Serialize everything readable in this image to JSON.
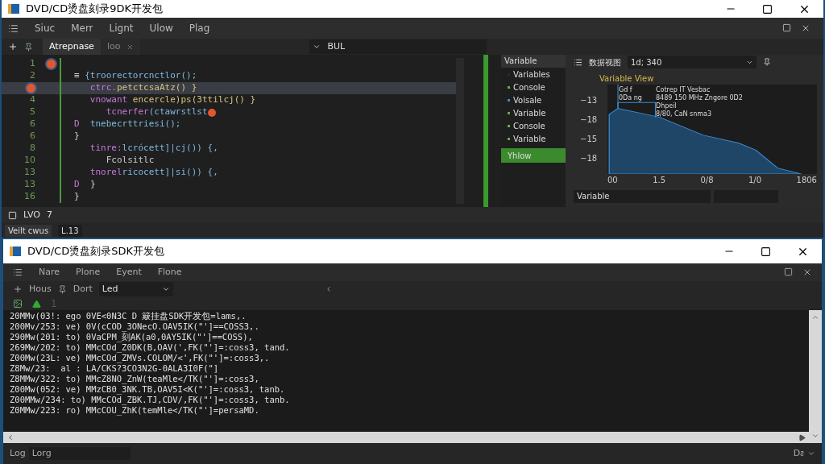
{
  "top_window": {
    "title": "DVD/CD烫盘刻录9DK开发包",
    "menu": [
      "Siuc",
      "Merr",
      "Lignt",
      "Ulow",
      "Plag"
    ],
    "tabs": [
      {
        "label": "Atrepnase",
        "selected": true,
        "closable": false
      },
      {
        "label": "loo",
        "selected": false,
        "closable": true
      }
    ],
    "search": {
      "value": "BUL"
    },
    "code_lines": [
      {
        "number": "1",
        "current": false,
        "gutter_breakpoint": true,
        "number_breakpoint": false,
        "end_breakpoint": false
      },
      {
        "number": "2",
        "current": false,
        "gutter_breakpoint": false,
        "number_breakpoint": false,
        "end_breakpoint": false,
        "parts": [
          {
            "kind": "punct",
            "text": "≡ "
          },
          {
            "kind": "name",
            "text": "{troorectorcnctlor();"
          }
        ]
      },
      {
        "current": true,
        "gutter_breakpoint": false,
        "number_breakpoint": true,
        "end_breakpoint": false,
        "parts": [
          {
            "kind": "keyword",
            "text": "   ctrc."
          },
          {
            "kind": "call",
            "text": "petctcsaAtz() }"
          }
        ]
      },
      {
        "number": "4",
        "current": false,
        "gutter_breakpoint": false,
        "number_breakpoint": false,
        "end_breakpoint": false,
        "parts": [
          {
            "kind": "keyword",
            "text": "   vnowant "
          },
          {
            "kind": "call",
            "text": "encercle)ps(3ttilcj() }"
          }
        ]
      },
      {
        "number": "5",
        "current": false,
        "gutter_breakpoint": false,
        "number_breakpoint": false,
        "end_breakpoint": true,
        "parts": [
          {
            "kind": "keyword",
            "text": "      tcnerfer"
          },
          {
            "kind": "name",
            "text": "(ctawrstlst"
          }
        ]
      },
      {
        "number": "6",
        "current": false,
        "gutter_breakpoint": false,
        "number_breakpoint": false,
        "end_breakpoint": false,
        "parts": [
          {
            "kind": "keyword",
            "text": "D  "
          },
          {
            "kind": "name",
            "text": "tnebecrttriesi();"
          }
        ]
      },
      {
        "number": "6",
        "current": false,
        "gutter_breakpoint": false,
        "number_breakpoint": false,
        "end_breakpoint": false,
        "parts": [
          {
            "kind": "punct",
            "text": "}"
          }
        ]
      },
      {
        "number": "8",
        "current": false,
        "gutter_breakpoint": false,
        "number_breakpoint": false,
        "end_breakpoint": false,
        "parts": [
          {
            "kind": "keyword",
            "text": "   tinre:"
          },
          {
            "kind": "name",
            "text": "lcrócett]|cj()) {,"
          }
        ]
      },
      {
        "number": "10",
        "current": false,
        "gutter_breakpoint": false,
        "number_breakpoint": false,
        "end_breakpoint": false,
        "parts": [
          {
            "kind": "plain",
            "text": "      Fcolsitlc"
          }
        ]
      },
      {
        "number": "13",
        "current": false,
        "gutter_breakpoint": false,
        "number_breakpoint": false,
        "end_breakpoint": false,
        "parts": [
          {
            "kind": "keyword",
            "text": "   tnorel"
          },
          {
            "kind": "name",
            "text": "ricocett]|si()) {,"
          }
        ]
      },
      {
        "number": "13",
        "current": false,
        "gutter_breakpoint": false,
        "number_breakpoint": false,
        "end_breakpoint": false,
        "parts": [
          {
            "kind": "keyword",
            "text": "D  "
          },
          {
            "kind": "punct",
            "text": "}"
          }
        ]
      },
      {
        "number": "16",
        "current": false,
        "gutter_breakpoint": false,
        "number_breakpoint": false,
        "end_breakpoint": false,
        "parts": [
          {
            "kind": "punct",
            "text": "}"
          }
        ]
      }
    ],
    "status": {
      "left": "LVO",
      "count": "7",
      "mode": "Veilt cwus",
      "position": "L.13"
    },
    "variables": {
      "header": "Variable",
      "items": [
        {
          "label": "Variables",
          "color": "#2b2b2b"
        },
        {
          "label": "Console",
          "color": "#6aa84f"
        },
        {
          "label": "Voisale",
          "color": "#4a86c8"
        },
        {
          "label": "Variable",
          "color": "#6aa84f"
        },
        {
          "label": "Console",
          "color": "#6aa84f"
        },
        {
          "label": "Variable",
          "color": "#6aa84f"
        }
      ],
      "button": "Yhlow"
    },
    "chart_panel": {
      "toolbar_label": "数据视图",
      "dropdown": "1d; 340",
      "title": "Variable View",
      "annotations": [
        "Gd f",
        "0Da ng",
        "Cotrep IT Vesbac",
        "8489 150 MHz Zngore 0D2",
        "Dhpeil",
        "8/80, CaN snma3"
      ],
      "y_ticks": [
        "−13",
        "−18",
        "−15",
        "−18"
      ],
      "x_ticks": [
        "00",
        "1.5",
        "0/8",
        "1/0",
        "1806"
      ],
      "footer": "Variable"
    }
  },
  "bottom_window": {
    "title": "DVD/CD烫盘刻录SDK开发包",
    "menu": [
      "Nare",
      "Plone",
      "Eyent",
      "Flone"
    ],
    "toolbar": {
      "add": "Hous",
      "pin": "Dort",
      "dropdown": "Led"
    },
    "row_count": "1",
    "log_lines": [
      "20MMv(03!: ego 0VE<0N3C D 簸挂盘SDK开发包=lams,.",
      "200Mv/253: ve) 0V(cCOD_3ONecO.OAV5IK(\"']==COSS3,.",
      "290Mw(201: to) 0VaCPM_刻AK(a0,0AY5IK(\"']==COSS),",
      "269Mw/202: to) MMcCOd_Z0DK(B,OAV(',FK(\"']=:coss3, tand.",
      "Z00Mw(23L: ve) MMcCOd_ZMVs.COLOM/<',FK(\"']=:coss3,.",
      "Z8Mw/23:  al : LA/CKS?3CO3N2G-0ALA3I0F(\"]",
      "Z8MMw/322: to) MMcZ8NO_ZnW(teaMle</TK(\"']=:coss3,",
      "Z00Mw(052: ve) MMzCB0_3NK.TB,OAV5I<K(\"']=:coss3, tanb.",
      "Z00MMw/234: to) MMcCOd_ZBK.TJ,CDV/,FK(\"']=:coss3, tanb.",
      "Z0MMw/223: ro) MMcCOU_ZhK(temMle</TK(\"']=persaMD."
    ],
    "footer": {
      "label": "Log",
      "field": "Lorg",
      "right": "Dᴤ"
    }
  }
}
